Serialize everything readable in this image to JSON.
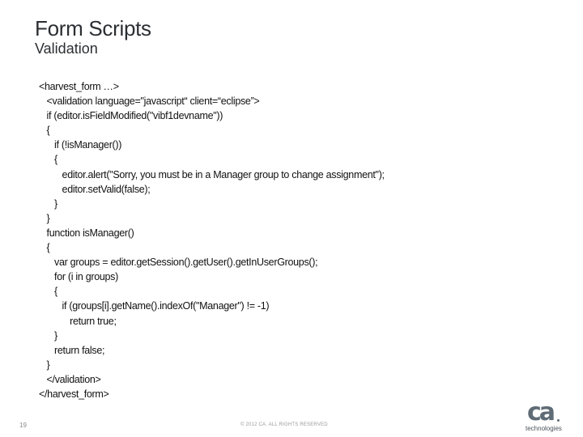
{
  "slide": {
    "title": "Form Scripts",
    "subtitle": "Validation",
    "code_lines": [
      "<harvest_form …>",
      "   <validation language=\"javascript“ client=“eclipse”>",
      "   if (editor.isFieldModified(\"vibf1devname\"))",
      "   {",
      "      if (!isManager())",
      "      {",
      "         editor.alert(\"Sorry, you must be in a Manager group to change assignment\");",
      "         editor.setValid(false);",
      "      }",
      "   }",
      "   function isManager()",
      "   {",
      "      var groups = editor.getSession().getUser().getInUserGroups();",
      "      for (i in groups)",
      "      {",
      "         if (groups[i].getName().indexOf(\"Manager\") != -1)",
      "            return true;",
      "      }",
      "      return false;",
      "   }",
      "   </validation>",
      "</harvest_form>"
    ]
  },
  "footer": {
    "page_number": "19",
    "copyright": "© 2012 CA. ALL RIGHTS RESERVED",
    "logo_mark": "ca",
    "logo_text": "technologies"
  }
}
